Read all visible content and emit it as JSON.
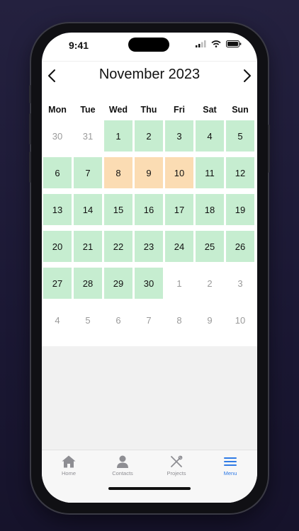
{
  "status": {
    "time": "9:41"
  },
  "calendar": {
    "title": "November 2023",
    "weekdays": [
      "Mon",
      "Tue",
      "Wed",
      "Thu",
      "Fri",
      "Sat",
      "Sun"
    ],
    "cells": [
      {
        "day": "30",
        "state": "muted"
      },
      {
        "day": "31",
        "state": "muted"
      },
      {
        "day": "1",
        "state": "green"
      },
      {
        "day": "2",
        "state": "green"
      },
      {
        "day": "3",
        "state": "green"
      },
      {
        "day": "4",
        "state": "green"
      },
      {
        "day": "5",
        "state": "green"
      },
      {
        "day": "6",
        "state": "green"
      },
      {
        "day": "7",
        "state": "green"
      },
      {
        "day": "8",
        "state": "orange"
      },
      {
        "day": "9",
        "state": "orange"
      },
      {
        "day": "10",
        "state": "orange"
      },
      {
        "day": "11",
        "state": "green"
      },
      {
        "day": "12",
        "state": "green"
      },
      {
        "day": "13",
        "state": "green"
      },
      {
        "day": "14",
        "state": "green"
      },
      {
        "day": "15",
        "state": "green"
      },
      {
        "day": "16",
        "state": "green"
      },
      {
        "day": "17",
        "state": "green"
      },
      {
        "day": "18",
        "state": "green"
      },
      {
        "day": "19",
        "state": "green"
      },
      {
        "day": "20",
        "state": "green"
      },
      {
        "day": "21",
        "state": "green"
      },
      {
        "day": "22",
        "state": "green"
      },
      {
        "day": "23",
        "state": "green"
      },
      {
        "day": "24",
        "state": "green"
      },
      {
        "day": "25",
        "state": "green"
      },
      {
        "day": "26",
        "state": "green"
      },
      {
        "day": "27",
        "state": "green"
      },
      {
        "day": "28",
        "state": "green"
      },
      {
        "day": "29",
        "state": "green"
      },
      {
        "day": "30",
        "state": "green"
      },
      {
        "day": "1",
        "state": "muted"
      },
      {
        "day": "2",
        "state": "muted"
      },
      {
        "day": "3",
        "state": "muted"
      },
      {
        "day": "4",
        "state": "muted"
      },
      {
        "day": "5",
        "state": "muted"
      },
      {
        "day": "6",
        "state": "muted"
      },
      {
        "day": "7",
        "state": "muted"
      },
      {
        "day": "8",
        "state": "muted"
      },
      {
        "day": "9",
        "state": "muted"
      },
      {
        "day": "10",
        "state": "muted"
      }
    ]
  },
  "tabs": [
    {
      "label": "Home",
      "icon": "home-icon",
      "active": false
    },
    {
      "label": "Contacts",
      "icon": "person-icon",
      "active": false
    },
    {
      "label": "Projects",
      "icon": "tools-icon",
      "active": false
    },
    {
      "label": "Menu",
      "icon": "menu-icon",
      "active": true
    }
  ],
  "colors": {
    "available": "#c6edd0",
    "partial": "#fbdcb3",
    "accent": "#2f7ae5",
    "muted_text": "#9a9a9a"
  }
}
